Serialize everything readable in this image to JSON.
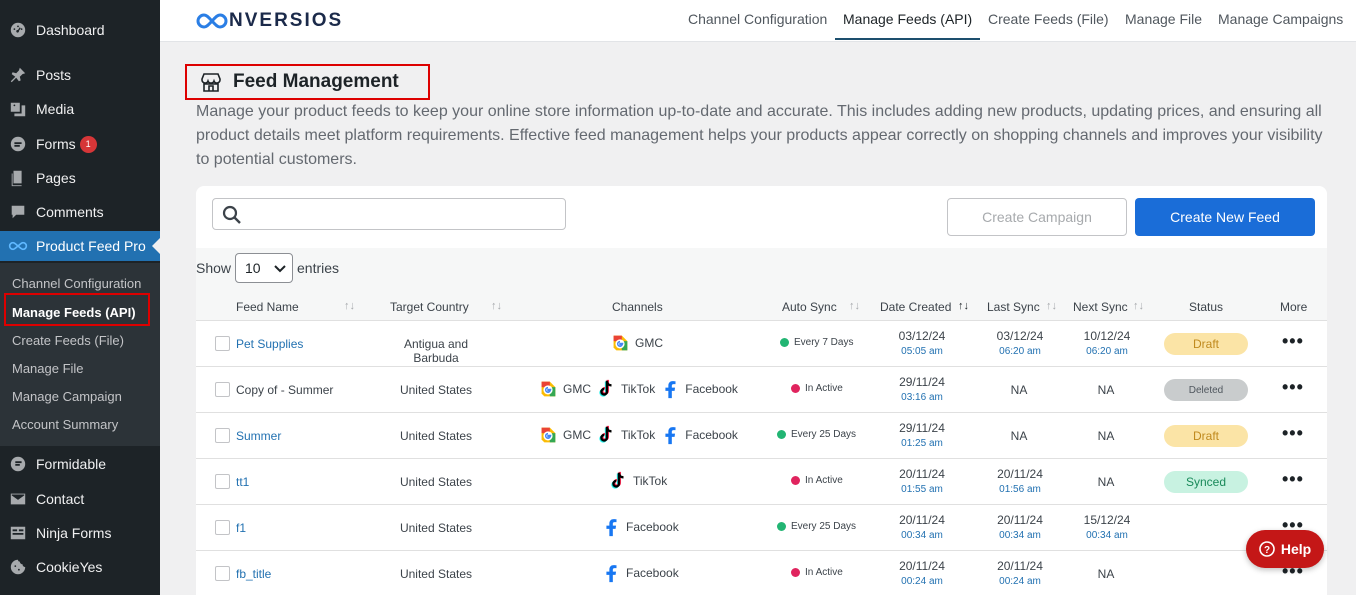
{
  "sidebar": {
    "items": [
      {
        "label": "Dashboard",
        "icon": "dashboard-icon"
      },
      {
        "label": "Posts",
        "icon": "pin-icon"
      },
      {
        "label": "Media",
        "icon": "media-icon"
      },
      {
        "label": "Forms",
        "icon": "forms-icon",
        "badge": "1"
      },
      {
        "label": "Pages",
        "icon": "pages-icon"
      },
      {
        "label": "Comments",
        "icon": "comments-icon"
      },
      {
        "label": "Product Feed Pro",
        "icon": "infinity-icon"
      },
      {
        "label": "Formidable",
        "icon": "formidable-icon"
      },
      {
        "label": "Contact",
        "icon": "mail-icon"
      },
      {
        "label": "Ninja Forms",
        "icon": "ninja-icon"
      },
      {
        "label": "CookieYes",
        "icon": "cookie-icon"
      }
    ],
    "submenu": [
      "Channel Configuration",
      "Manage Feeds (API)",
      "Create Feeds (File)",
      "Manage File",
      "Manage Campaign",
      "Account Summary"
    ]
  },
  "topnav": {
    "logo": "NVERSIOS",
    "links": [
      "Channel Configuration",
      "Manage Feeds (API)",
      "Create Feeds (File)",
      "Manage File",
      "Manage Campaigns"
    ]
  },
  "page": {
    "title": "Feed Management",
    "description": "Manage your product feeds to keep your online store information up-to-date and accurate. This includes adding new products, updating prices, and ensuring all product details meet platform requirements. Effective feed management helps your products appear correctly on shopping channels and improves your visibility to potential customers."
  },
  "toolbar": {
    "search_placeholder": "",
    "create_campaign": "Create Campaign",
    "create_new_feed": "Create New Feed"
  },
  "entries": {
    "show": "Show",
    "value": "10",
    "label": "entries"
  },
  "table": {
    "headers": [
      "Feed Name",
      "Target Country",
      "Channels",
      "Auto Sync",
      "Date Created",
      "Last Sync",
      "Next Sync",
      "Status",
      "More"
    ],
    "rows": [
      {
        "name": "Pet Supplies",
        "country": "Antigua and Barbuda",
        "channels": [
          "GMC"
        ],
        "sync": "Every 7 Days",
        "sync_color": "#22b573",
        "created_d": "03/12/24",
        "created_t": "05:05 am",
        "last_d": "03/12/24",
        "last_t": "06:20 am",
        "next_d": "10/12/24",
        "next_t": "06:20 am",
        "status": "Draft"
      },
      {
        "name": "Copy of - Summer",
        "country": "United States",
        "channels": [
          "GMC",
          "TikTok",
          "Facebook"
        ],
        "sync": "In Active",
        "sync_color": "#e0245e",
        "created_d": "29/11/24",
        "created_t": "03:16 am",
        "last_d": "NA",
        "last_t": "",
        "next_d": "NA",
        "next_t": "",
        "status": "Deleted"
      },
      {
        "name": "Summer",
        "country": "United States",
        "channels": [
          "GMC",
          "TikTok",
          "Facebook"
        ],
        "sync": "Every 25 Days",
        "sync_color": "#22b573",
        "created_d": "29/11/24",
        "created_t": "01:25 am",
        "last_d": "NA",
        "last_t": "",
        "next_d": "NA",
        "next_t": "",
        "status": "Draft"
      },
      {
        "name": "tt1",
        "country": "United States",
        "channels": [
          "TikTok"
        ],
        "sync": "In Active",
        "sync_color": "#e0245e",
        "created_d": "20/11/24",
        "created_t": "01:55 am",
        "last_d": "20/11/24",
        "last_t": "01:56 am",
        "next_d": "NA",
        "next_t": "",
        "status": "Synced"
      },
      {
        "name": "f1",
        "country": "United States",
        "channels": [
          "Facebook"
        ],
        "sync": "Every 25 Days",
        "sync_color": "#22b573",
        "created_d": "20/11/24",
        "created_t": "00:34 am",
        "last_d": "20/11/24",
        "last_t": "00:34 am",
        "next_d": "15/12/24",
        "next_t": "00:34 am",
        "status": ""
      },
      {
        "name": "fb_title",
        "country": "United States",
        "channels": [
          "Facebook"
        ],
        "sync": "In Active",
        "sync_color": "#e0245e",
        "created_d": "20/11/24",
        "created_t": "00:24 am",
        "last_d": "20/11/24",
        "last_t": "00:24 am",
        "next_d": "NA",
        "next_t": "",
        "status": ""
      }
    ]
  },
  "status_colors": {
    "Draft": {
      "bg": "#fbe4a6",
      "fg": "#c08a1e"
    },
    "Deleted": {
      "bg": "#c9cccd",
      "fg": "#50575e"
    },
    "Synced": {
      "bg": "#c8f2e1",
      "fg": "#1a8a5a"
    }
  },
  "help": {
    "label": "Help"
  }
}
